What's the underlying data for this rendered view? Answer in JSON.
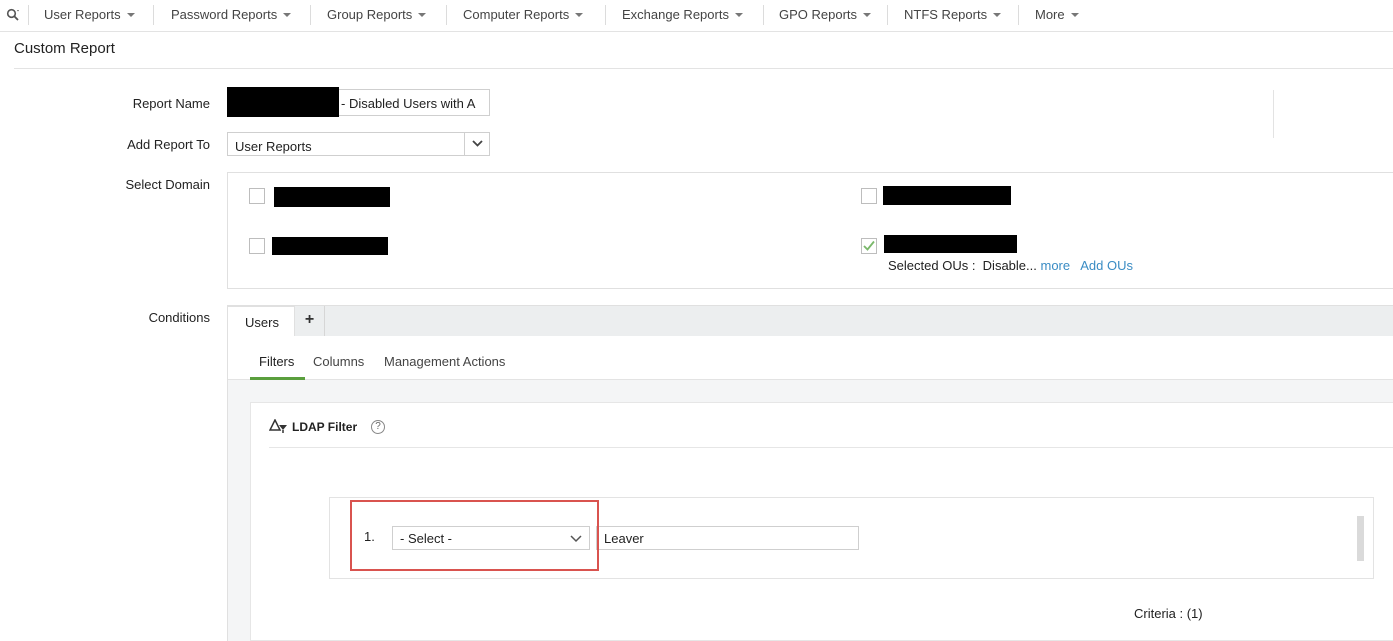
{
  "nav": {
    "items": [
      {
        "label": "User Reports"
      },
      {
        "label": "Password Reports"
      },
      {
        "label": "Group Reports"
      },
      {
        "label": "Computer Reports"
      },
      {
        "label": "Exchange Reports"
      },
      {
        "label": "GPO Reports"
      },
      {
        "label": "NTFS Reports"
      },
      {
        "label": "More"
      }
    ]
  },
  "page": {
    "title": "Custom Report"
  },
  "form": {
    "report_name_label": "Report Name",
    "report_name_suffix": "- Disabled Users with A",
    "add_report_to_label": "Add Report To",
    "add_report_to_value": "User Reports",
    "select_domain_label": "Select Domain",
    "conditions_label": "Conditions"
  },
  "domains": {
    "selected_ous_label": "Selected OUs :",
    "selected_ous_value": "Disable...",
    "more_link": "more",
    "add_ous_link": "Add OUs"
  },
  "conditions": {
    "tab_users": "Users",
    "tab_add": "+",
    "subtabs": {
      "filters": "Filters",
      "columns": "Columns",
      "management_actions": "Management Actions"
    },
    "ldap_filter_title": "LDAP Filter",
    "help": "?",
    "criteria_row": {
      "number": "1.",
      "select_value": "- Select -",
      "input_value": "Leaver"
    },
    "criteria_count": "Criteria : (1)"
  },
  "colors": {
    "accent_green": "#5a9f3d",
    "link_blue": "#3a8cc4",
    "highlight_red": "#d9534f"
  }
}
